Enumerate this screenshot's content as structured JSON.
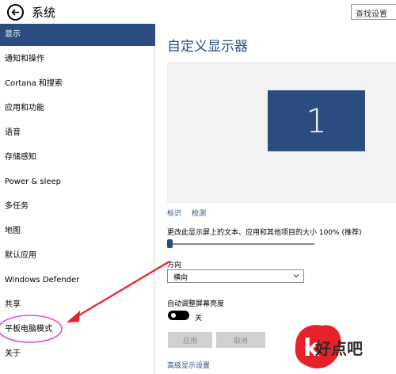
{
  "window": {
    "title": "系统",
    "search_placeholder": "查找设置"
  },
  "sidebar": {
    "items": [
      {
        "label": "显示",
        "selected": true
      },
      {
        "label": "通知和操作"
      },
      {
        "label": "Cortana 和搜索"
      },
      {
        "label": "应用和功能"
      },
      {
        "label": "语音"
      },
      {
        "label": "存储感知"
      },
      {
        "label": "Power & sleep"
      },
      {
        "label": "多任务"
      },
      {
        "label": "地图"
      },
      {
        "label": "默认应用"
      },
      {
        "label": "Windows Defender"
      },
      {
        "label": "共享"
      },
      {
        "label": "平板电脑模式",
        "highlighted": true
      },
      {
        "label": "关于"
      }
    ]
  },
  "main": {
    "heading": "自定义显示器",
    "monitor_number": "1",
    "identify_link": "标识",
    "detect_link": "检测",
    "scale_label": "更改此显示屏上的文本、应用和其他项目的大小 100% (推荐)",
    "scale_percent": 100,
    "orientation_label": "方向",
    "orientation_value": "横向",
    "brightness_label": "自动调整屏幕亮度",
    "brightness_toggle": "关",
    "brightness_on": false,
    "apply_button": "应用",
    "cancel_button": "取消",
    "advanced_link": "高级显示设置"
  },
  "watermark": {
    "text": "好点吧"
  },
  "colors": {
    "accent": "#2b4c7e",
    "annotation": "#e8202a",
    "highlight_circle": "#e04bd0"
  }
}
